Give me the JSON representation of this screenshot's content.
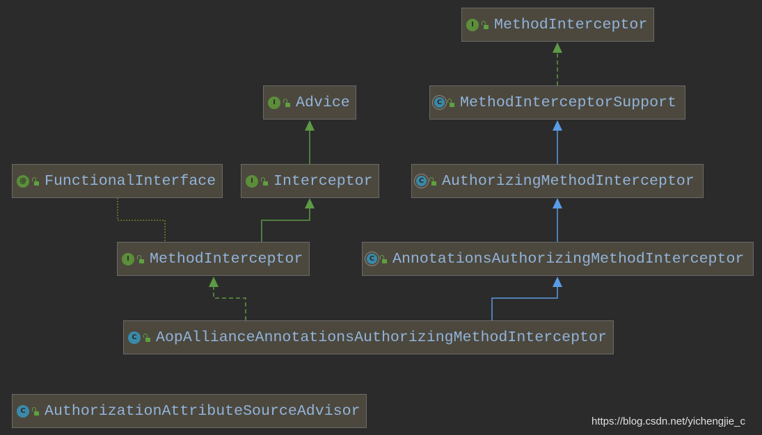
{
  "nodes": [
    {
      "name": "MethodInterceptor",
      "kind": "interface",
      "icon": "I"
    },
    {
      "name": "Advice",
      "kind": "interface",
      "icon": "I"
    },
    {
      "name": "MethodInterceptorSupport",
      "kind": "abstract-class",
      "icon": "C"
    },
    {
      "name": "FunctionalInterface",
      "kind": "annotation",
      "icon": "@"
    },
    {
      "name": "Interceptor",
      "kind": "interface",
      "icon": "I"
    },
    {
      "name": "AuthorizingMethodInterceptor",
      "kind": "abstract-class",
      "icon": "C"
    },
    {
      "name": "MethodInterceptor",
      "kind": "interface",
      "icon": "I"
    },
    {
      "name": "AnnotationsAuthorizingMethodInterceptor",
      "kind": "abstract-class",
      "icon": "C"
    },
    {
      "name": "AopAllianceAnnotationsAuthorizingMethodInterceptor",
      "kind": "class",
      "icon": "C"
    },
    {
      "name": "AuthorizationAttributeSourceAdvisor",
      "kind": "class",
      "icon": "C"
    }
  ],
  "edges": [
    {
      "from": "MethodInterceptorSupport",
      "to": "MethodInterceptor (top)",
      "type": "implements"
    },
    {
      "from": "Interceptor",
      "to": "Advice",
      "type": "extends"
    },
    {
      "from": "AuthorizingMethodInterceptor",
      "to": "MethodInterceptorSupport",
      "type": "extends-class"
    },
    {
      "from": "MethodInterceptor",
      "to": "Interceptor",
      "type": "extends"
    },
    {
      "from": "MethodInterceptor",
      "to": "FunctionalInterface",
      "type": "annotated"
    },
    {
      "from": "AnnotationsAuthorizingMethodInterceptor",
      "to": "AuthorizingMethodInterceptor",
      "type": "extends-class"
    },
    {
      "from": "AopAllianceAnnotationsAuthorizingMethodInterceptor",
      "to": "MethodInterceptor",
      "type": "implements"
    },
    {
      "from": "AopAllianceAnnotationsAuthorizingMethodInterceptor",
      "to": "AnnotationsAuthorizingMethodInterceptor",
      "type": "extends-class"
    }
  ],
  "colors": {
    "background": "#2b2b2b",
    "node": "#4c483e",
    "text": "#92b3d9",
    "implements": "#5c9a45",
    "extends_class": "#5a9be6",
    "annotation": "#8a8a2a"
  },
  "watermark": "https://blog.csdn.net/yichengjie_c"
}
